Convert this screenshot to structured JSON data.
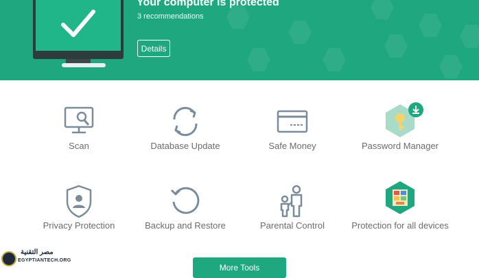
{
  "header": {
    "title": "Your computer is protected",
    "subtitle": "3 recommendations",
    "details_label": "Details",
    "background_color": "#1fa77f"
  },
  "tools": [
    {
      "label": "Scan",
      "icon": "scan-icon"
    },
    {
      "label": "Database Update",
      "icon": "database-update-icon"
    },
    {
      "label": "Safe Money",
      "icon": "safe-money-icon"
    },
    {
      "label": "Password Manager",
      "icon": "password-manager-icon",
      "badge": "download-badge-icon"
    },
    {
      "label": "Privacy Protection",
      "icon": "privacy-protection-icon"
    },
    {
      "label": "Backup and Restore",
      "icon": "backup-restore-icon"
    },
    {
      "label": "Parental Control",
      "icon": "parental-control-icon"
    },
    {
      "label": "Protection for all devices",
      "icon": "protection-all-devices-icon"
    }
  ],
  "more_tools_label": "More Tools",
  "watermark": {
    "line1": "مصر التقنية",
    "line2": "EGYPTIANTECH.ORG"
  },
  "colors": {
    "accent": "#1fa77f",
    "icon_gray": "#7a8c9a",
    "label_gray": "#6b6b6b"
  }
}
